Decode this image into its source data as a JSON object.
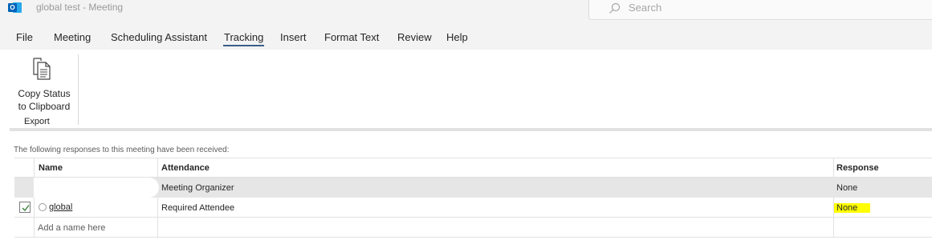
{
  "window": {
    "title": "global test  -  Meeting",
    "app_icon_letter": "O",
    "search_placeholder": "Search"
  },
  "menu": {
    "tabs": [
      {
        "label": "File"
      },
      {
        "label": "Meeting"
      },
      {
        "label": "Scheduling Assistant"
      },
      {
        "label": "Tracking",
        "active": true
      },
      {
        "label": "Insert"
      },
      {
        "label": "Format Text"
      },
      {
        "label": "Review"
      },
      {
        "label": "Help"
      }
    ]
  },
  "ribbon": {
    "copy_status_line1": "Copy Status",
    "copy_status_line2": "to Clipboard",
    "group_label": "Export",
    "icon": "copy-document-icon"
  },
  "tracking": {
    "info": "The following responses to this meeting have been received:",
    "headers": {
      "name": "Name",
      "attendance": "Attendance",
      "response": "Response"
    },
    "organizer": {
      "attendance": "Meeting Organizer",
      "response": "None"
    },
    "attendees": [
      {
        "name": "global",
        "attendance": "Required Attendee",
        "response": "None",
        "checked": true,
        "response_highlight": "#ffff00"
      }
    ],
    "add_placeholder": "Add a name here"
  },
  "colors": {
    "accent": "#3b5e8c",
    "outlook_blue": "#0364b8",
    "highlight": "#ffff00",
    "check_green": "#2e7d32"
  }
}
